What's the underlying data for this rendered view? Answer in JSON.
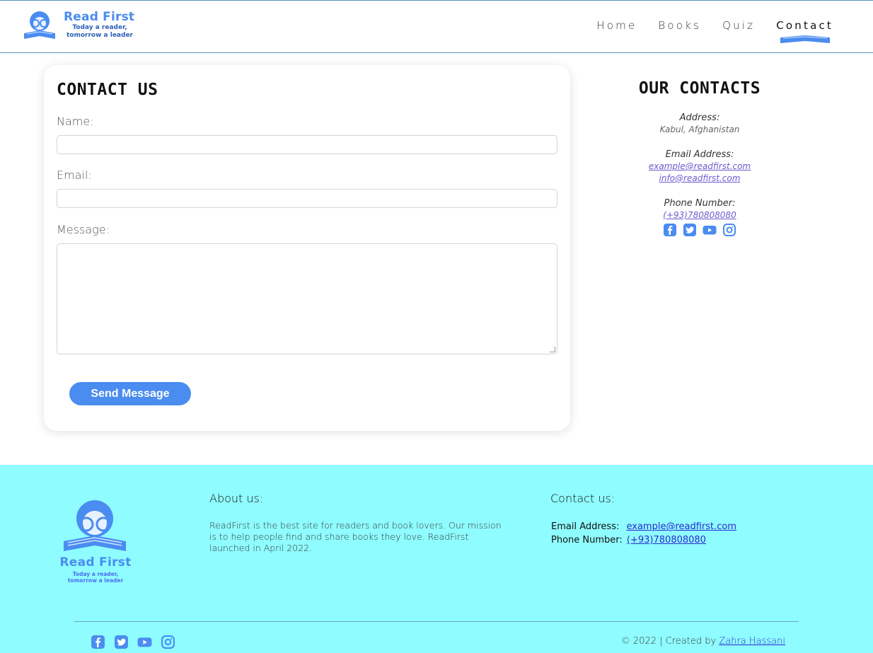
{
  "brand": {
    "name": "Read First",
    "tagline_line1": "Today a reader,",
    "tagline_line2": "tomorrow a leader",
    "accent_color": "#4a8cf0"
  },
  "nav": {
    "items": [
      {
        "label": "Home"
      },
      {
        "label": "Books"
      },
      {
        "label": "Quiz"
      },
      {
        "label": "Contact",
        "active": true
      }
    ]
  },
  "contact_form": {
    "title": "CONTACT US",
    "name_label": "Name:",
    "name_value": "",
    "email_label": "Email:",
    "email_value": "",
    "message_label": "Message:",
    "message_value": "",
    "submit_label": "Send Message"
  },
  "our_contacts": {
    "title": "OUR CONTACTS",
    "address_label": "Address:",
    "address_value": "Kabul, Afghanistan",
    "email_label": "Email Address:",
    "emails": [
      "example@readfirst.com",
      "info@readfirst.com"
    ],
    "phone_label": "Phone Number:",
    "phone_value": "(+93)780808080",
    "social_icons": [
      "facebook-icon",
      "twitter-icon",
      "youtube-icon",
      "instagram-icon"
    ]
  },
  "footer": {
    "background": "#8ffcff",
    "about_heading": "About us:",
    "about_text": "ReadFirst is the best site for readers and book lovers. Our mission is to help people find and share books they love. ReadFirst launched in April 2022.",
    "contact_heading": "Contact us:",
    "email_label": "Email Address:",
    "email_value": "example@readfirst.com",
    "phone_label": "Phone Number:",
    "phone_value": "(+93)780808080",
    "copyright_text": "© 2022 | Created by",
    "author_name": "Zahra Hassani"
  }
}
